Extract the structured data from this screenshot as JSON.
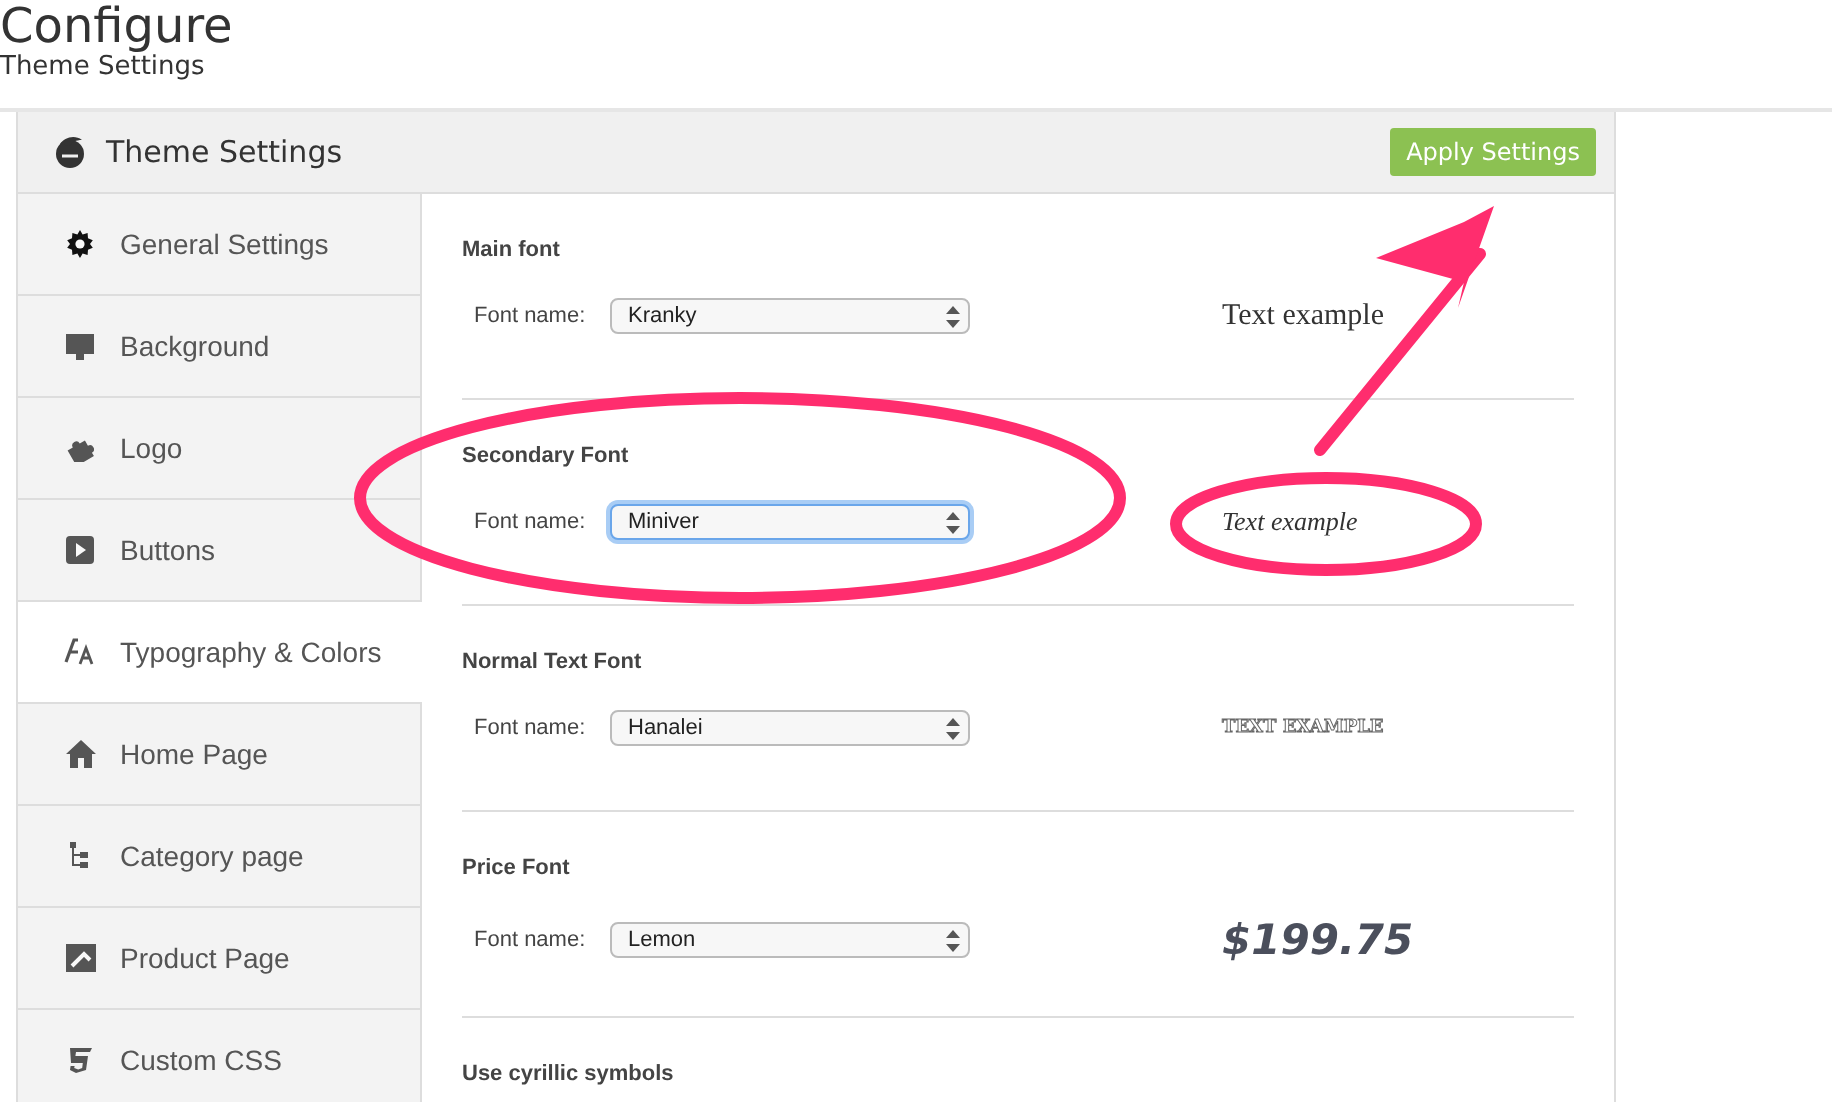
{
  "page": {
    "title": "Configure",
    "subtitle": "Theme Settings"
  },
  "panel": {
    "title": "Theme Settings",
    "apply_button": "Apply Settings"
  },
  "sidebar": {
    "items": [
      {
        "label": "General Settings",
        "selected": false
      },
      {
        "label": "Background",
        "selected": false
      },
      {
        "label": "Logo",
        "selected": false
      },
      {
        "label": "Buttons",
        "selected": false
      },
      {
        "label": "Typography & Colors",
        "selected": true
      },
      {
        "label": "Home Page",
        "selected": false
      },
      {
        "label": "Category page",
        "selected": false
      },
      {
        "label": "Product Page",
        "selected": false
      },
      {
        "label": "Custom CSS",
        "selected": false
      }
    ]
  },
  "sections": [
    {
      "title": "Main font",
      "field_label": "Font name:",
      "value": "Kranky",
      "focused": false,
      "preview": "Text example"
    },
    {
      "title": "Secondary Font",
      "field_label": "Font name:",
      "value": "Miniver",
      "focused": true,
      "preview": "Text example"
    },
    {
      "title": "Normal Text Font",
      "field_label": "Font name:",
      "value": "Hanalei",
      "focused": false,
      "preview": "TEXT EXAMPLE"
    },
    {
      "title": "Price Font",
      "field_label": "Font name:",
      "value": "Lemon",
      "focused": false,
      "preview": "$199.75"
    },
    {
      "title": "Use cyrillic symbols"
    }
  ]
}
